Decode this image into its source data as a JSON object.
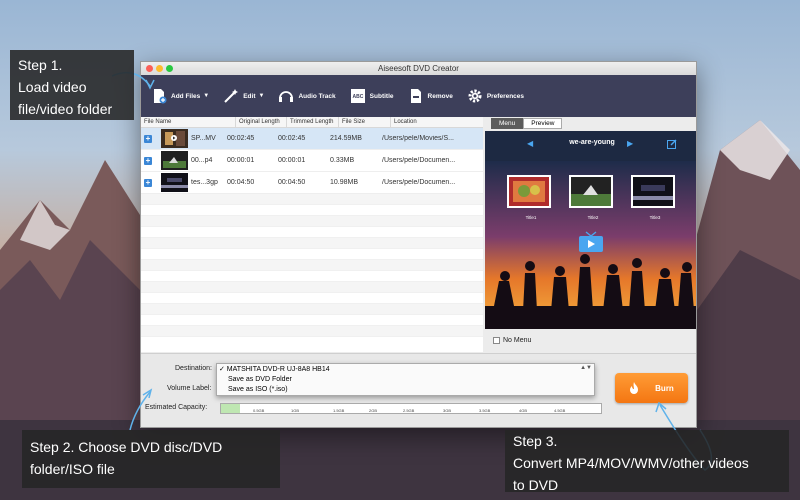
{
  "window": {
    "title": "Aiseesoft DVD Creator"
  },
  "toolbar": {
    "add_files": "Add Files",
    "edit": "Edit",
    "audio_track": "Audio Track",
    "subtitle": "Subtitle",
    "remove": "Remove",
    "preferences": "Preferences"
  },
  "filelist": {
    "columns": [
      "File Name",
      "Original Length",
      "Trimmed Length",
      "File Size",
      "Location"
    ],
    "rows": [
      {
        "name": "SP...MV",
        "original": "00:02:45",
        "trimmed": "00:02:45",
        "size": "214.59MB",
        "location": "/Users/pele/Movies/S..."
      },
      {
        "name": "00...p4",
        "original": "00:00:01",
        "trimmed": "00:00:01",
        "size": "0.33MB",
        "location": "/Users/pele/Documen..."
      },
      {
        "name": "tes...3gp",
        "original": "00:04:50",
        "trimmed": "00:04:50",
        "size": "10.98MB",
        "location": "/Users/pele/Documen..."
      }
    ]
  },
  "preview": {
    "tabs": [
      "Menu",
      "Preview"
    ],
    "menu_title": "we-are-young",
    "titles": [
      "Title1",
      "Title2",
      "Title3"
    ],
    "no_menu": "No Menu"
  },
  "bottom": {
    "destination_label": "Destination:",
    "volume_label": "Volume Label:",
    "capacity_label": "Estimated Capacity:",
    "destination_options": [
      "✓ MATSHITA DVD-R   UJ-8A8 HB14",
      "Save as DVD Folder",
      "Save as ISO (*.iso)"
    ],
    "capacity_ticks": [
      "0.5GB",
      "1GB",
      "1.5GB",
      "2GB",
      "2.5GB",
      "3GB",
      "3.5GB",
      "4GB",
      "4.5GB"
    ],
    "capacity_used_fraction": 0.05,
    "burn": "Burn"
  },
  "callouts": {
    "step1": [
      "Step 1.",
      "Load video",
      "file/video folder"
    ],
    "step2": [
      "Step 2. Choose DVD disc/DVD",
      "folder/ISO file"
    ],
    "step3": [
      "Step 3.",
      "Convert MP4/MOV/WMV/other videos",
      "to DVD"
    ]
  },
  "colors": {
    "toolbar": "#3d3f5a",
    "accent": "#3b87d6",
    "burn": "#f47612"
  }
}
